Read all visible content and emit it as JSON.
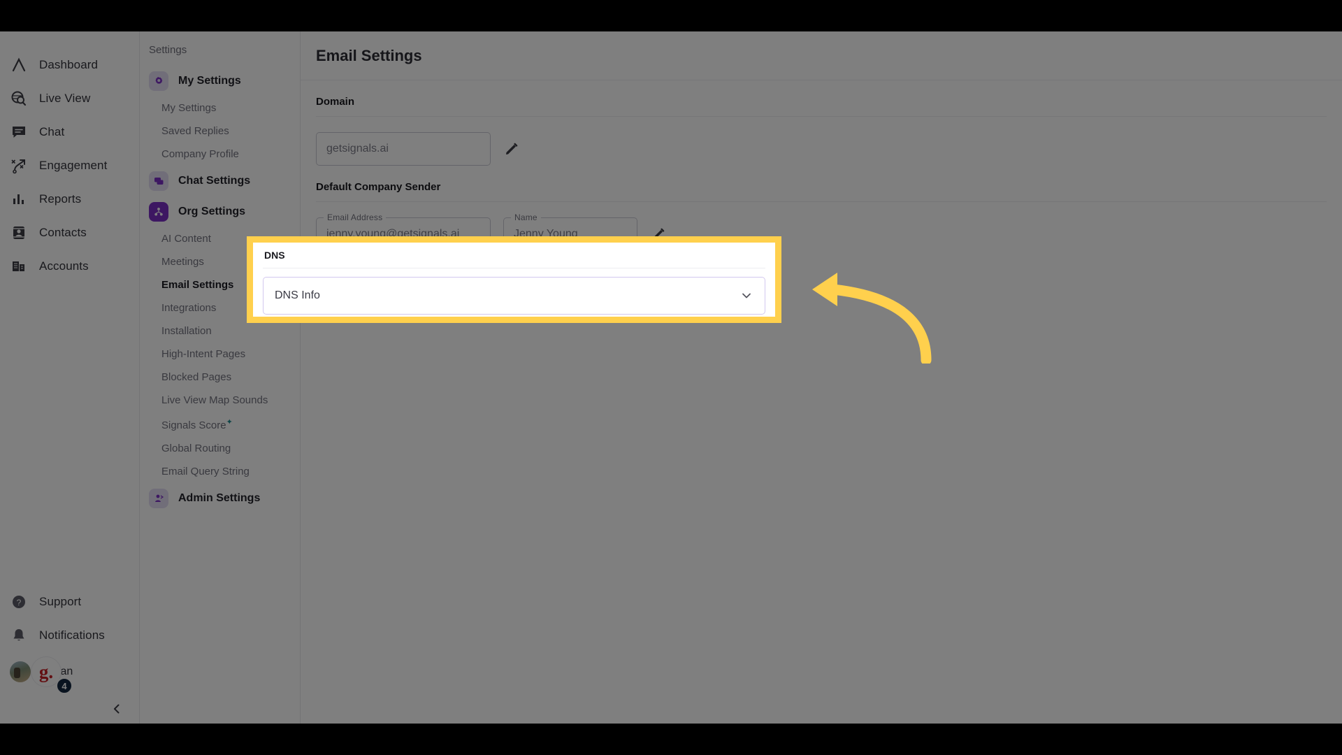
{
  "rail": {
    "items": [
      {
        "label": "Dashboard",
        "icon": "logo-chevron-icon"
      },
      {
        "label": "Live View",
        "icon": "globe-search-icon"
      },
      {
        "label": "Chat",
        "icon": "chat-bubble-icon"
      },
      {
        "label": "Engagement",
        "icon": "engagement-flow-icon"
      },
      {
        "label": "Reports",
        "icon": "bar-chart-icon"
      },
      {
        "label": "Contacts",
        "icon": "contact-card-icon"
      },
      {
        "label": "Accounts",
        "icon": "buildings-icon"
      }
    ],
    "bottom": [
      {
        "label": "Support",
        "icon": "help-circle-icon"
      },
      {
        "label": "Notifications",
        "icon": "bell-icon"
      }
    ],
    "user": {
      "name": "Ngan",
      "badge_letter": "g.",
      "notification_count": "4"
    },
    "collapse_icon": "chevron-left-icon"
  },
  "subnav": {
    "title": "Settings",
    "groups": [
      {
        "label": "My Settings",
        "icon": "gear-icon",
        "state": "muted",
        "items": [
          {
            "label": "My Settings",
            "selected": false
          },
          {
            "label": "Saved Replies",
            "selected": false
          },
          {
            "label": "Company Profile",
            "selected": false
          }
        ]
      },
      {
        "label": "Chat Settings",
        "icon": "chat-settings-icon",
        "state": "muted",
        "items": []
      },
      {
        "label": "Org Settings",
        "icon": "org-tree-icon",
        "state": "active",
        "items": [
          {
            "label": "AI Content",
            "selected": false
          },
          {
            "label": "Meetings",
            "selected": false
          },
          {
            "label": "Email Settings",
            "selected": true
          },
          {
            "label": "Integrations",
            "selected": false
          },
          {
            "label": "Installation",
            "selected": false
          },
          {
            "label": "High-Intent Pages",
            "selected": false
          },
          {
            "label": "Blocked Pages",
            "selected": false
          },
          {
            "label": "Live View Map Sounds",
            "selected": false
          },
          {
            "label": "Signals Score",
            "selected": false,
            "superscript": "✦"
          },
          {
            "label": "Global Routing",
            "selected": false
          },
          {
            "label": "Email Query String",
            "selected": false
          }
        ]
      },
      {
        "label": "Admin Settings",
        "icon": "admin-person-icon",
        "state": "muted",
        "items": []
      }
    ]
  },
  "main": {
    "title": "Email Settings",
    "domain": {
      "section_label": "Domain",
      "value": "getsignals.ai",
      "edit_icon": "pencil-icon"
    },
    "sender": {
      "section_label": "Default Company Sender",
      "email_legend": "Email Address",
      "email_value": "jenny.young@getsignals.ai",
      "name_legend": "Name",
      "name_value": "Jenny Young",
      "edit_icon": "pencil-icon"
    },
    "dns": {
      "section_label": "DNS",
      "accordion_label": "DNS Info",
      "chevron_icon": "chevron-down-icon"
    }
  },
  "annotation": {
    "highlight_color": "#ffd04d",
    "arrow_icon": "curved-arrow-left-icon",
    "accent_purple": "#7b2fc4"
  }
}
